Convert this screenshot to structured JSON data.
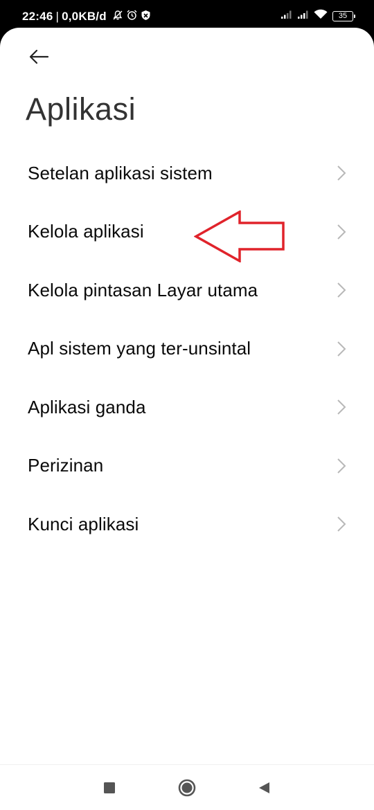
{
  "status_bar": {
    "time": "22:46",
    "separator": "|",
    "net_speed": "0,0KB/d",
    "battery_level": "35",
    "icons": [
      "notifications-off-icon",
      "alarm-icon",
      "shield-icon",
      "signal-icon",
      "signal-icon",
      "wifi-icon",
      "battery-icon"
    ]
  },
  "header": {
    "back_icon": "arrow-left-icon",
    "title": "Aplikasi"
  },
  "menu": {
    "items": [
      {
        "label": "Setelan aplikasi sistem"
      },
      {
        "label": "Kelola aplikasi"
      },
      {
        "label": "Kelola pintasan Layar utama"
      },
      {
        "label": "Apl sistem yang ter-unsintal"
      },
      {
        "label": "Aplikasi ganda"
      },
      {
        "label": "Perizinan"
      },
      {
        "label": "Kunci aplikasi"
      }
    ],
    "chevron_icon": "chevron-right-icon"
  },
  "annotation": {
    "icon": "red-arrow-left-outline",
    "color": "#e0232b"
  },
  "nav_bar": {
    "icons": [
      "recents-square-icon",
      "home-circle-icon",
      "back-triangle-icon"
    ]
  },
  "colors": {
    "background": "#ffffff",
    "status_bar": "#000000",
    "text_primary": "#0a0a0a",
    "title": "#333333",
    "chevron": "#b8b8b8",
    "annotation": "#e0232b",
    "nav_icons": "#555555"
  }
}
